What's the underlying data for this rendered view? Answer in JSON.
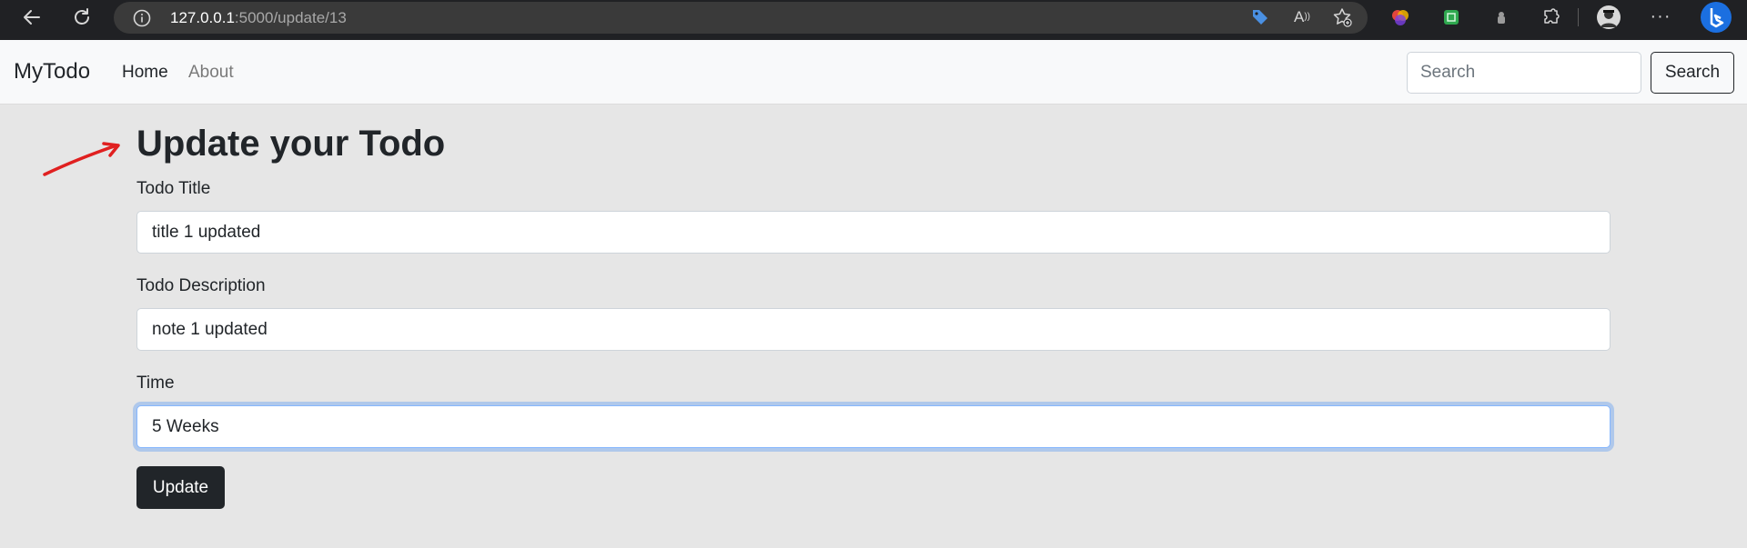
{
  "browser": {
    "url_host": "127.0.0.1",
    "url_path": ":5000/update/13",
    "icons": [
      "back-icon",
      "refresh-icon",
      "info-icon",
      "tag-icon",
      "read-aloud-icon",
      "favorites-icon",
      "copilot-icon",
      "collections-icon",
      "extension-icon",
      "puzzle-icon",
      "profile-avatar",
      "more-icon",
      "bing-icon"
    ]
  },
  "navbar": {
    "brand": "MyTodo",
    "links": [
      {
        "label": "Home",
        "active": true
      },
      {
        "label": "About",
        "active": false
      }
    ],
    "search_placeholder": "Search",
    "search_button": "Search"
  },
  "main": {
    "title": "Update your Todo",
    "fields": [
      {
        "label": "Todo Title",
        "value": "title 1 updated"
      },
      {
        "label": "Todo Description",
        "value": "note 1 updated"
      },
      {
        "label": "Time",
        "value": "5 Weeks"
      }
    ],
    "submit_label": "Update"
  },
  "colors": {
    "page_bg": "#e6e6e6",
    "navbar_bg": "#f8f9fa",
    "button_dark": "#212529",
    "annotation_arrow": "#e02020",
    "focus_ring": "#86b7fe"
  }
}
